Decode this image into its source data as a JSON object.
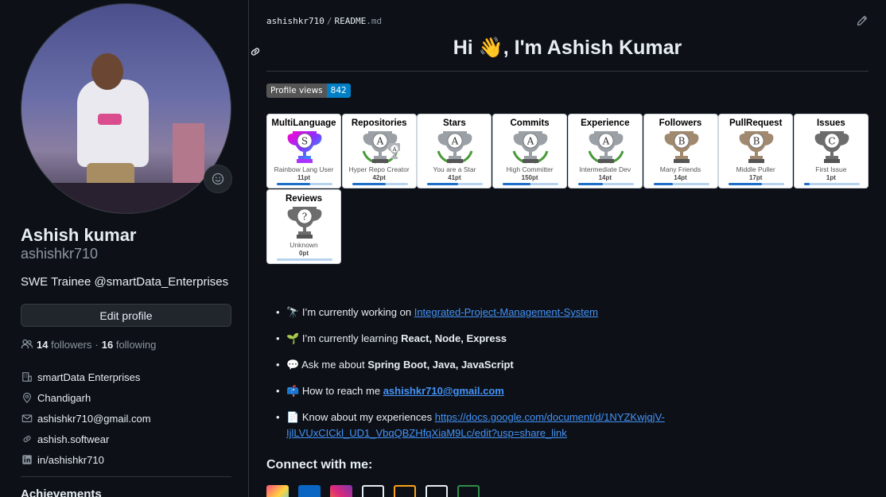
{
  "profile": {
    "name": "Ashish kumar",
    "login": "ashishkr710",
    "bio": "SWE Trainee @smartData_Enterprises",
    "edit_label": "Edit profile",
    "followers_count": "14",
    "followers_label": "followers",
    "dot": "·",
    "following_count": "16",
    "following_label": "following",
    "details": {
      "company": "smartData Enterprises",
      "location": "Chandigarh",
      "email": "ashishkr710@gmail.com",
      "website": "ashish.softwear",
      "linkedin": "in/ashishkr710"
    },
    "achievements_label": "Achievements"
  },
  "readme": {
    "path_user": "ashishkr710",
    "path_sep": "/",
    "path_file": "README",
    "path_ext": ".md",
    "heading": "Hi 👋, I'm Ashish Kumar",
    "views_badge": {
      "label": "Profile views",
      "count": "842"
    },
    "trophies": [
      {
        "title": "MultiLanguage",
        "rank": "S",
        "sub": "Rainbow Lang User",
        "pt": "11pt",
        "progress": 0.6,
        "color": "rainbow"
      },
      {
        "title": "Repositories",
        "rank": "A",
        "sub": "Hyper Repo Creator",
        "pt": "42pt",
        "progress": 0.6,
        "color": "#9aa0a6",
        "extra": "A"
      },
      {
        "title": "Stars",
        "rank": "A",
        "sub": "You are a Star",
        "pt": "41pt",
        "progress": 0.55,
        "color": "#9aa0a6"
      },
      {
        "title": "Commits",
        "rank": "A",
        "sub": "High Committer",
        "pt": "150pt",
        "progress": 0.5,
        "color": "#9aa0a6"
      },
      {
        "title": "Experience",
        "rank": "A",
        "sub": "Intermediate Dev",
        "pt": "14pt",
        "progress": 0.45,
        "color": "#9aa0a6"
      },
      {
        "title": "Followers",
        "rank": "B",
        "sub": "Many Friends",
        "pt": "14pt",
        "progress": 0.35,
        "color": "#a0896e"
      },
      {
        "title": "PullRequest",
        "rank": "B",
        "sub": "Middle Puller",
        "pt": "17pt",
        "progress": 0.6,
        "color": "#a0896e"
      },
      {
        "title": "Issues",
        "rank": "C",
        "sub": "First Issue",
        "pt": "1pt",
        "progress": 0.1,
        "color": "#6d6d6d"
      },
      {
        "title": "Reviews",
        "rank": "?",
        "sub": "Unknown",
        "pt": "0pt",
        "progress": 0,
        "color": "#6d6d6d"
      }
    ],
    "items": [
      {
        "emoji": "🔭",
        "text": "I’m currently working on ",
        "link": "Integrated-Project-Management-System"
      },
      {
        "emoji": "🌱",
        "text": "I’m currently learning ",
        "bold": "React, Node, Express"
      },
      {
        "emoji": "💬",
        "text": "Ask me about ",
        "bold": "Spring Boot, Java, JavaScript"
      },
      {
        "emoji": "📫",
        "text": "How to reach me ",
        "link": "ashishkr710@gmail.com"
      },
      {
        "emoji": "📄",
        "text": "Know about my experiences ",
        "link": "https://docs.google.com/document/d/1NYZKwjqjV-IjlLVUxCICkl_UD1_VbqQBZHfqXiaM9Lc/edit?usp=share_link"
      }
    ],
    "connect_heading": "Connect with me:",
    "socials": [
      "dev-to",
      "linkedin",
      "instagram",
      "hackerrank",
      "leetcode",
      "codechef",
      "geeksforgeeks"
    ]
  }
}
